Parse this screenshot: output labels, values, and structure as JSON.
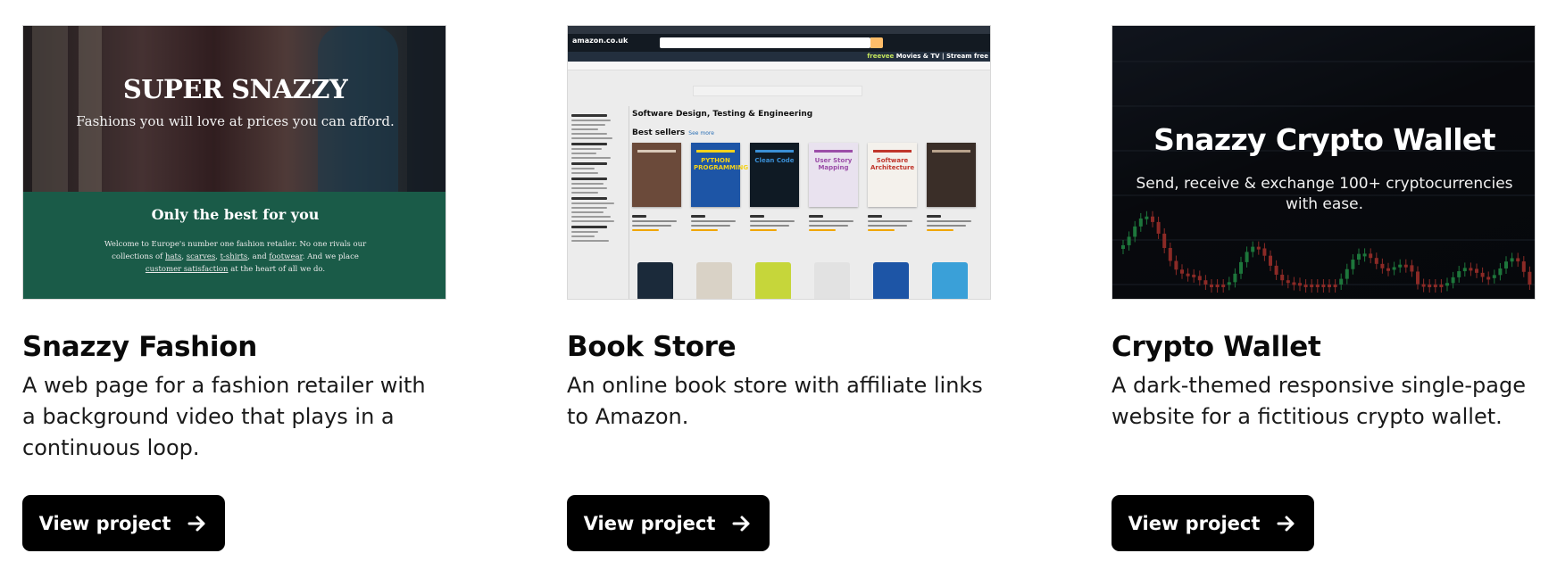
{
  "projects": [
    {
      "title": "Snazzy Fashion",
      "description": "A web page for a fashion retailer with a background video that plays in a continuous loop.",
      "button_label": "View project",
      "preview": {
        "headline": "SUPER SNAZZY",
        "tagline": "Fashions you will love at prices you can afford.",
        "section_heading": "Only the best for you",
        "body_start": "Welcome to Europe's number one fashion retailer. No one rivals our collections of ",
        "links": [
          "hats",
          "scarves",
          "t-shirts",
          "footwear",
          "customer satisfaction"
        ],
        "body_join_1": ", ",
        "body_join_2": ", ",
        "body_join_3": ", and ",
        "body_mid": ". And we place ",
        "body_end": " at the heart of all we do.",
        "colors": {
          "band": "#1a5b48"
        }
      }
    },
    {
      "title": "Book Store",
      "description": "An online book store with affiliate links to Amazon.",
      "button_label": "View project",
      "preview": {
        "logo": "amazon.co.uk",
        "promo_brand": "freevee",
        "promo_text": "Movies & TV | Stream free",
        "section_title": "Software Design, Testing & Engineering",
        "best_sellers": "Best sellers",
        "see_more": "See more",
        "books": [
          {
            "cover_text": "",
            "color": "#6b4a3a",
            "accent": "#d9c8b8"
          },
          {
            "cover_text": "PYTHON PROGRAMMING",
            "color": "#1d55a6",
            "accent": "#f3d21c"
          },
          {
            "cover_text": "Clean Code",
            "color": "#0f1a24",
            "accent": "#3a8fd6"
          },
          {
            "cover_text": "User Story Mapping",
            "color": "#e9e2ef",
            "accent": "#9b4da8"
          },
          {
            "cover_text": "Software Architecture",
            "color": "#f4f1ec",
            "accent": "#c0362c"
          },
          {
            "cover_text": "",
            "color": "#3a2e28",
            "accent": "#b8a28c"
          }
        ]
      }
    },
    {
      "title": "Crypto Wallet",
      "description": "A dark-themed responsive single-page website for a fictitious crypto wallet.",
      "button_label": "View project",
      "preview": {
        "headline": "Snazzy Crypto Wallet",
        "subheadline": "Send, receive & exchange 100+ cryptocurrencies with ease.",
        "colors": {
          "up": "#2fbf5f",
          "down": "#e0443e"
        }
      }
    }
  ],
  "icons": {
    "button_icon": "arrow-right-icon"
  }
}
